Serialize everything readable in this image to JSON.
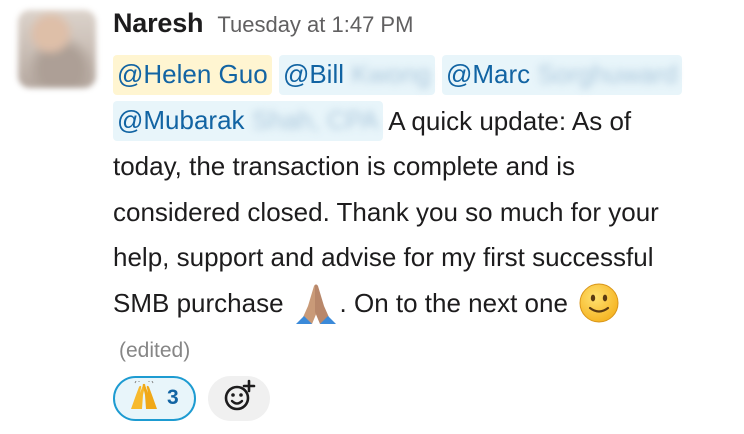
{
  "message": {
    "author": "Naresh",
    "timestamp": "Tuesday at 1:47 PM",
    "mentions": [
      {
        "visible": "@Helen Guo",
        "hidden": ""
      },
      {
        "visible": "@Bill",
        "hidden": "Kwong"
      },
      {
        "visible": "@Marc",
        "hidden": "Sorghuward"
      },
      {
        "visible": "@Mubarak",
        "hidden": "Shah, CPA"
      }
    ],
    "text_lines": [
      "A quick update: As of",
      "today, the transaction is complete and is",
      "considered closed. Thank you so much for your",
      "help, support and advise for my first successful",
      "SMB purchase",
      ". On to the next one"
    ],
    "emoji": {
      "hands": "folded-hands-icon",
      "smile": "slightly-smiling-face-icon"
    },
    "edited_label": "(edited)"
  },
  "reactions": [
    {
      "emoji": "raised-hands-icon",
      "count": "3"
    }
  ],
  "add_reaction": {
    "icon": "add-reaction-icon"
  },
  "colors": {
    "mention_text": "#1264a3",
    "mention_bg": "#e8f5fa",
    "self_mention_bg": "#fff5d1",
    "reaction_border": "#1d9bd1"
  }
}
